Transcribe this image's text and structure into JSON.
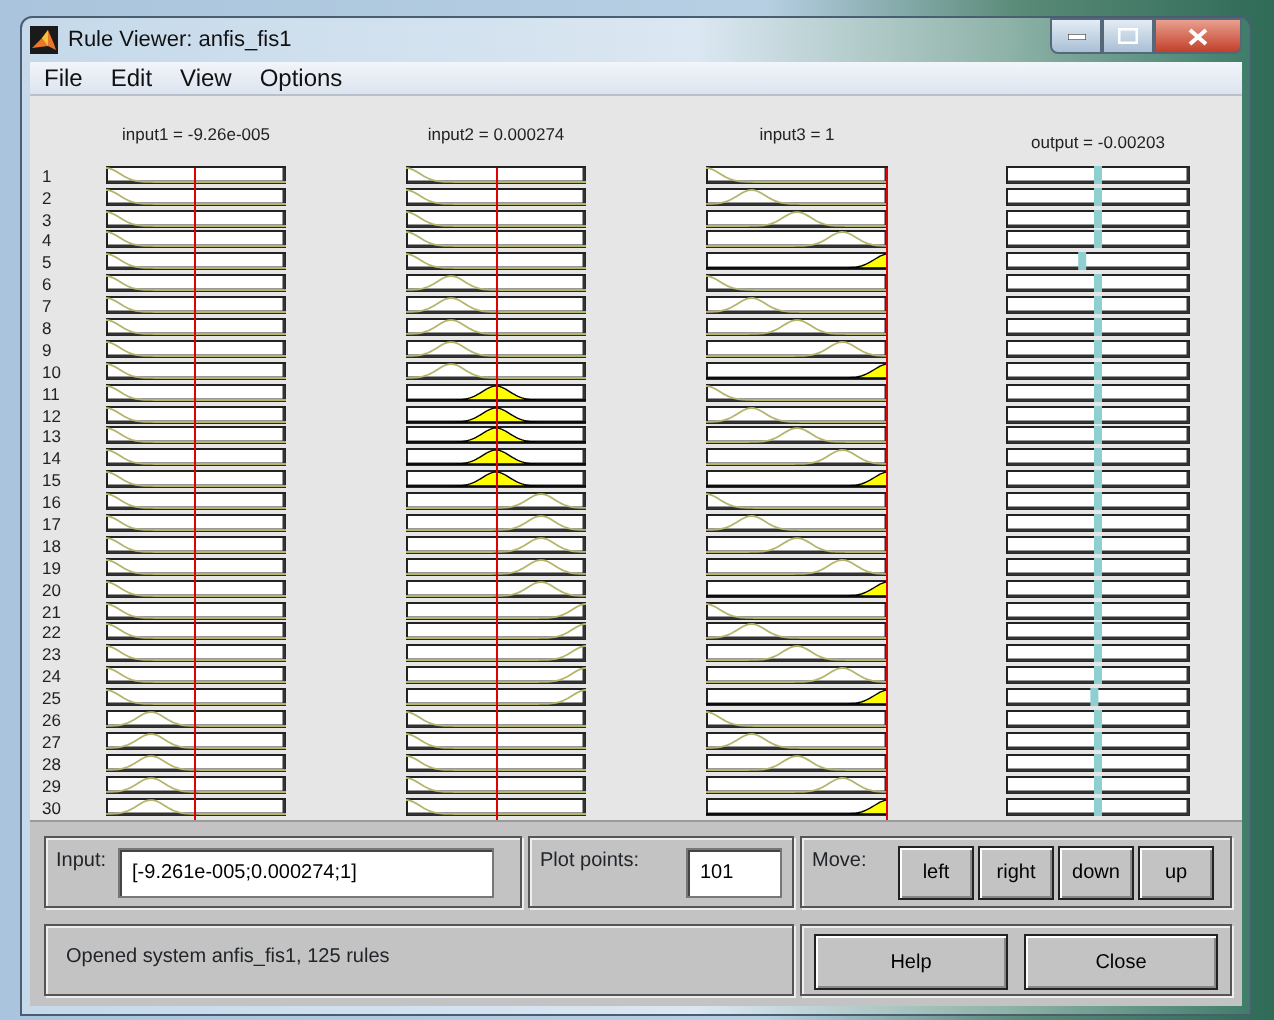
{
  "window": {
    "title": "Rule Viewer: anfis_fis1"
  },
  "menu": [
    "File",
    "Edit",
    "View",
    "Options"
  ],
  "inputs": [
    {
      "label": "input1 = -9.26e-005"
    },
    {
      "label": "input2 = 0.000274"
    },
    {
      "label": "input3 = 1"
    }
  ],
  "output": {
    "label": "output = -0.00203"
  },
  "rows": [
    {
      "number": "1",
      "cells": [
        {
          "kind": "mf1",
          "fired": false
        },
        {
          "kind": "mf1",
          "fired": false
        },
        {
          "kind": "mf1",
          "fired": false
        }
      ],
      "level": 0.5
    },
    {
      "number": "2",
      "cells": [
        {
          "kind": "mf1",
          "fired": false
        },
        {
          "kind": "mf1",
          "fired": false
        },
        {
          "kind": "mf2",
          "fired": false
        }
      ],
      "level": 0.5
    },
    {
      "number": "3",
      "cells": [
        {
          "kind": "mf1",
          "fired": false
        },
        {
          "kind": "mf1",
          "fired": false
        },
        {
          "kind": "mf3",
          "fired": false
        }
      ],
      "level": 0.5
    },
    {
      "number": "4",
      "cells": [
        {
          "kind": "mf1",
          "fired": false
        },
        {
          "kind": "mf1",
          "fired": false
        },
        {
          "kind": "mf4",
          "fired": false
        }
      ],
      "level": 0.5
    },
    {
      "number": "5",
      "cells": [
        {
          "kind": "mf1",
          "fired": false
        },
        {
          "kind": "mf1",
          "fired": false
        },
        {
          "kind": "mf5",
          "fired": true
        }
      ],
      "level": 0.41
    },
    {
      "number": "6",
      "cells": [
        {
          "kind": "mf1",
          "fired": false
        },
        {
          "kind": "mf2",
          "fired": false
        },
        {
          "kind": "mf1",
          "fired": false
        }
      ],
      "level": 0.5
    },
    {
      "number": "7",
      "cells": [
        {
          "kind": "mf1",
          "fired": false
        },
        {
          "kind": "mf2",
          "fired": false
        },
        {
          "kind": "mf2",
          "fired": false
        }
      ],
      "level": 0.5
    },
    {
      "number": "8",
      "cells": [
        {
          "kind": "mf1",
          "fired": false
        },
        {
          "kind": "mf2",
          "fired": false
        },
        {
          "kind": "mf3",
          "fired": false
        }
      ],
      "level": 0.5
    },
    {
      "number": "9",
      "cells": [
        {
          "kind": "mf1",
          "fired": false
        },
        {
          "kind": "mf2",
          "fired": false
        },
        {
          "kind": "mf4",
          "fired": false
        }
      ],
      "level": 0.5
    },
    {
      "number": "10",
      "cells": [
        {
          "kind": "mf1",
          "fired": false
        },
        {
          "kind": "mf2",
          "fired": false
        },
        {
          "kind": "mf5",
          "fired": true
        }
      ],
      "level": 0.5
    },
    {
      "number": "11",
      "cells": [
        {
          "kind": "mf1",
          "fired": false
        },
        {
          "kind": "mf3",
          "fired": true
        },
        {
          "kind": "mf1",
          "fired": false
        }
      ],
      "level": 0.5
    },
    {
      "number": "12",
      "cells": [
        {
          "kind": "mf1",
          "fired": false
        },
        {
          "kind": "mf3",
          "fired": true
        },
        {
          "kind": "mf2",
          "fired": false
        }
      ],
      "level": 0.5
    },
    {
      "number": "13",
      "cells": [
        {
          "kind": "mf1",
          "fired": false
        },
        {
          "kind": "mf3",
          "fired": true
        },
        {
          "kind": "mf3",
          "fired": false
        }
      ],
      "level": 0.5
    },
    {
      "number": "14",
      "cells": [
        {
          "kind": "mf1",
          "fired": false
        },
        {
          "kind": "mf3",
          "fired": true
        },
        {
          "kind": "mf4",
          "fired": false
        }
      ],
      "level": 0.5
    },
    {
      "number": "15",
      "cells": [
        {
          "kind": "mf1",
          "fired": false
        },
        {
          "kind": "mf3",
          "fired": true
        },
        {
          "kind": "mf5",
          "fired": true
        }
      ],
      "level": 0.5
    },
    {
      "number": "16",
      "cells": [
        {
          "kind": "mf1",
          "fired": false
        },
        {
          "kind": "mf4",
          "fired": false
        },
        {
          "kind": "mf1",
          "fired": false
        }
      ],
      "level": 0.5
    },
    {
      "number": "17",
      "cells": [
        {
          "kind": "mf1",
          "fired": false
        },
        {
          "kind": "mf4",
          "fired": false
        },
        {
          "kind": "mf2",
          "fired": false
        }
      ],
      "level": 0.5
    },
    {
      "number": "18",
      "cells": [
        {
          "kind": "mf1",
          "fired": false
        },
        {
          "kind": "mf4",
          "fired": false
        },
        {
          "kind": "mf3",
          "fired": false
        }
      ],
      "level": 0.5
    },
    {
      "number": "19",
      "cells": [
        {
          "kind": "mf1",
          "fired": false
        },
        {
          "kind": "mf4",
          "fired": false
        },
        {
          "kind": "mf4",
          "fired": false
        }
      ],
      "level": 0.5
    },
    {
      "number": "20",
      "cells": [
        {
          "kind": "mf1",
          "fired": false
        },
        {
          "kind": "mf4",
          "fired": false
        },
        {
          "kind": "mf5",
          "fired": true
        }
      ],
      "level": 0.5
    },
    {
      "number": "21",
      "cells": [
        {
          "kind": "mf1",
          "fired": false
        },
        {
          "kind": "mf5",
          "fired": false
        },
        {
          "kind": "mf1",
          "fired": false
        }
      ],
      "level": 0.5
    },
    {
      "number": "22",
      "cells": [
        {
          "kind": "mf1",
          "fired": false
        },
        {
          "kind": "mf5",
          "fired": false
        },
        {
          "kind": "mf2",
          "fired": false
        }
      ],
      "level": 0.5
    },
    {
      "number": "23",
      "cells": [
        {
          "kind": "mf1",
          "fired": false
        },
        {
          "kind": "mf5",
          "fired": false
        },
        {
          "kind": "mf3",
          "fired": false
        }
      ],
      "level": 0.5
    },
    {
      "number": "24",
      "cells": [
        {
          "kind": "mf1",
          "fired": false
        },
        {
          "kind": "mf5",
          "fired": false
        },
        {
          "kind": "mf4",
          "fired": false
        }
      ],
      "level": 0.5
    },
    {
      "number": "25",
      "cells": [
        {
          "kind": "mf1",
          "fired": false
        },
        {
          "kind": "mf5",
          "fired": false
        },
        {
          "kind": "mf5",
          "fired": true
        }
      ],
      "level": 0.48
    },
    {
      "number": "26",
      "cells": [
        {
          "kind": "mf2",
          "fired": false
        },
        {
          "kind": "mf1",
          "fired": false
        },
        {
          "kind": "mf1",
          "fired": false
        }
      ],
      "level": 0.5
    },
    {
      "number": "27",
      "cells": [
        {
          "kind": "mf2",
          "fired": false
        },
        {
          "kind": "mf1",
          "fired": false
        },
        {
          "kind": "mf2",
          "fired": false
        }
      ],
      "level": 0.5
    },
    {
      "number": "28",
      "cells": [
        {
          "kind": "mf2",
          "fired": false
        },
        {
          "kind": "mf1",
          "fired": false
        },
        {
          "kind": "mf3",
          "fired": false
        }
      ],
      "level": 0.5
    },
    {
      "number": "29",
      "cells": [
        {
          "kind": "mf2",
          "fired": false
        },
        {
          "kind": "mf1",
          "fired": false
        },
        {
          "kind": "mf4",
          "fired": false
        }
      ],
      "level": 0.5
    },
    {
      "number": "30",
      "cells": [
        {
          "kind": "mf2",
          "fired": false
        },
        {
          "kind": "mf1",
          "fired": false
        },
        {
          "kind": "mf5",
          "fired": true
        }
      ],
      "level": 0.5
    }
  ],
  "input_field": {
    "label": "Input:",
    "value": "[-9.261e-005;0.000274;1]"
  },
  "plot_points": {
    "label": "Plot points:",
    "value": "101"
  },
  "move": {
    "label": "Move:",
    "buttons": [
      "left",
      "right",
      "down",
      "up"
    ]
  },
  "status": "Opened system anfis_fis1, 125 rules",
  "buttons": [
    "Help",
    "Close"
  ]
}
